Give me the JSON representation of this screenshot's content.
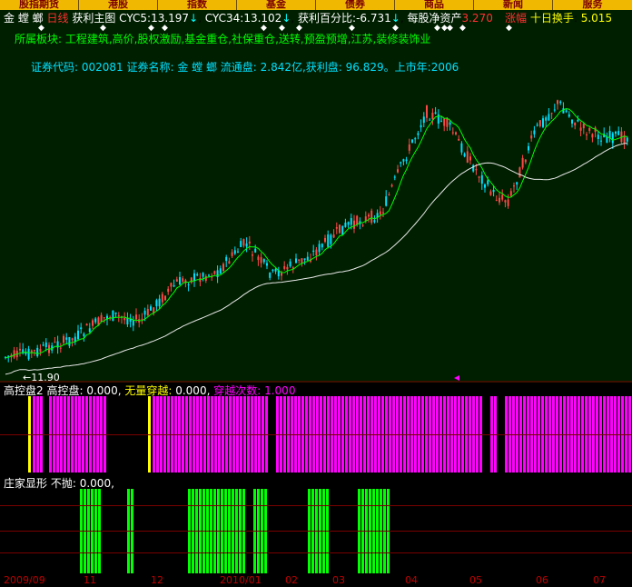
{
  "nav_tabs": [
    "股指期货",
    "港股",
    "指数",
    "基金",
    "债券",
    "商品",
    "新闻",
    "服务"
  ],
  "chart_header": {
    "stock_name": "金 螳 螂",
    "period": "日线",
    "chart_name": "获利主图",
    "cyc5_label": "CYC5:",
    "cyc5_value": "13.197",
    "cyc34_label": "CYC34:",
    "cyc34_value": "13.102",
    "profit_pct_label": "获利百分比:",
    "profit_pct_value": "-6.731",
    "nav_label": "每股净资产",
    "nav_value": "3.270",
    "change_label": "涨幅",
    "turnover_label": "十日换手",
    "turnover_value": "5.015"
  },
  "sector_info": "所属板块: 工程建筑,高价,股权激励,基金重仓,社保重仓,送转,预盈预增,江苏,装修装饰业",
  "stock_info": "证券代码: 002081 证券名称: 金 螳 螂  流通盘: 2.842亿,获利盘: 96.829。上市年:2006",
  "low_marker": "11.90",
  "panel2": {
    "name": "高控盘2",
    "ctrl_label": "高控盘:",
    "ctrl_value": "0.000,",
    "cross_label": "无量穿越:",
    "cross_value": "0.000,",
    "count_label": "穿越次数:",
    "count_value": "1.000"
  },
  "panel3": {
    "name": "庄家显形",
    "hold_label": "不抛:",
    "hold_value": "0.000,"
  },
  "time_axis": [
    "2009/09",
    "11",
    "12",
    "2010/01",
    "02",
    "03",
    "04",
    "05",
    "06",
    "07"
  ],
  "colors": {
    "up_candle": "#ff4848",
    "down_candle": "#00e0ff",
    "ma_short": "#00ff00",
    "ma_long": "#e8e8e8",
    "magenta_bar": "#ff00ff",
    "green_bar": "#00ff00",
    "tab_bg": "#f0b800",
    "grid_red": "#7a0000"
  },
  "chart_data": {
    "type": "candlestick",
    "series": [
      {
        "name": "CYC5",
        "last": 13.197
      },
      {
        "name": "CYC34",
        "last": 13.102
      }
    ],
    "min_label": 11.9
  }
}
